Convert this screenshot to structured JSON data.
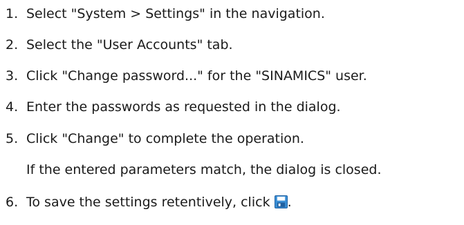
{
  "steps": [
    {
      "number": "1.",
      "text": "Select \"System > Settings\" in the navigation."
    },
    {
      "number": "2.",
      "text": "Select the \"User Accounts\" tab."
    },
    {
      "number": "3.",
      "text": "Click \"Change password...\" for the \"SINAMICS\" user."
    },
    {
      "number": "4.",
      "text": "Enter the passwords as requested in the dialog."
    },
    {
      "number": "5.",
      "text": "Click \"Change\" to complete the operation."
    },
    {
      "number": "6.",
      "text": "To save the settings retentively, click",
      "trailing": ".",
      "icon": "save-icon"
    }
  ],
  "result_text": "If the entered parameters match, the dialog is closed.",
  "colors": {
    "text": "#1a1a1a",
    "icon_blue": "#3a8fd6",
    "icon_dark": "#1f5f9f"
  }
}
